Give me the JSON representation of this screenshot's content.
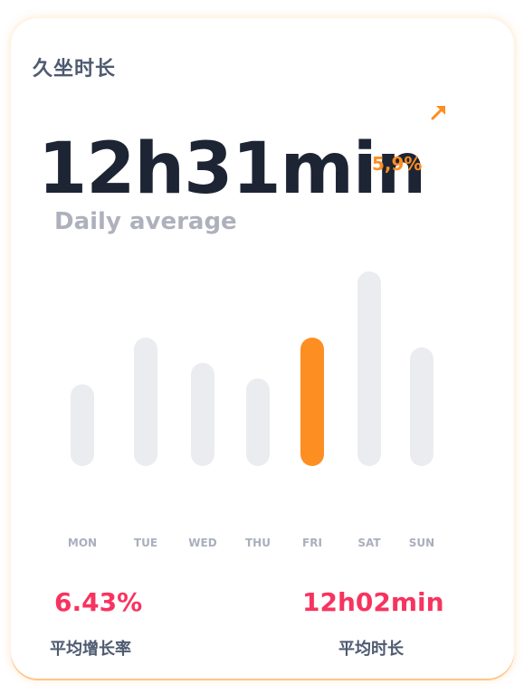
{
  "card": {
    "title": "久坐时长",
    "trend_icon": "arrow-up-right-icon",
    "main_value": "12h31min",
    "change_value": "5,9%",
    "subtitle": "Daily average"
  },
  "colors": {
    "accent": "#FD8E22",
    "inactive_bar": "#EBECEF",
    "value_title": "#1D2433",
    "stat_red": "#F7335F",
    "label_gray": "#A9AFBD"
  },
  "chart_data": {
    "type": "bar",
    "categories": [
      "MON",
      "TUE",
      "WED",
      "THU",
      "FRI",
      "SAT",
      "SUN"
    ],
    "values": [
      0.42,
      0.66,
      0.53,
      0.45,
      0.66,
      1.0,
      0.61
    ],
    "highlight_index": 4,
    "title": "",
    "xlabel": "",
    "ylabel": "",
    "ylim": [
      0,
      1
    ]
  },
  "stats": {
    "left": {
      "value": "6.43%",
      "label": "平均增长率"
    },
    "right": {
      "value": "12h02min",
      "label": "平均时长"
    }
  }
}
